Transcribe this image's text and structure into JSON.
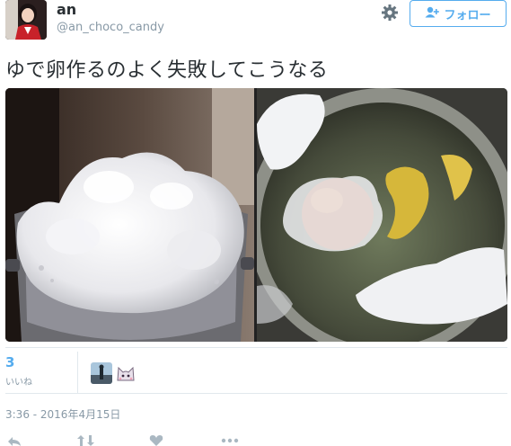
{
  "user": {
    "display_name": "an",
    "handle": "@an_choco_candy"
  },
  "follow_button": {
    "label": "フォロー"
  },
  "tweet": {
    "text": "ゆで卵作るのよく失敗してこうなる"
  },
  "stats": {
    "likes_count": "3",
    "likes_label": "いいね"
  },
  "timestamp": "3:36 - 2016年4月15日",
  "colors": {
    "accent": "#55acee",
    "muted": "#8899a6",
    "text": "#292f33",
    "border": "#e1e8ed"
  },
  "icons": [
    "gear-icon",
    "follow-person-icon",
    "reply-icon",
    "retweet-icon",
    "like-icon",
    "more-icon"
  ]
}
